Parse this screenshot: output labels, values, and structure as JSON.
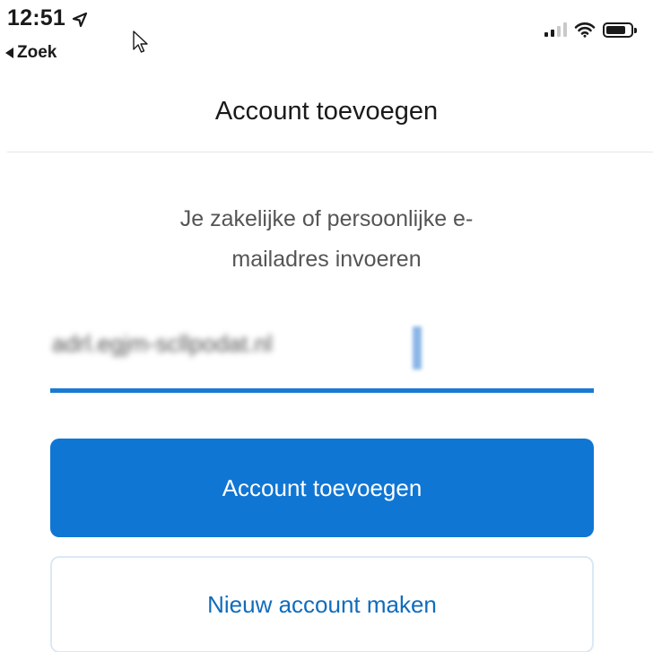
{
  "status_bar": {
    "time": "12:51",
    "back_label": "Zoek",
    "icons": [
      "location-arrow-icon",
      "cellular-signal-icon",
      "wifi-icon",
      "battery-icon"
    ]
  },
  "header": {
    "title": "Account toevoegen"
  },
  "form": {
    "prompt_line1": "Je zakelijke of persoonlijke e-",
    "prompt_line2": "mailadres invoeren",
    "email_value": "adrl.egjm-scllpodat.nl"
  },
  "buttons": {
    "add_account": "Account toevoegen",
    "new_account": "Nieuw account maken"
  },
  "colors": {
    "accent": "#0f76d4",
    "underline": "#1a7ad4",
    "secondary_text": "#0f6cbd"
  }
}
